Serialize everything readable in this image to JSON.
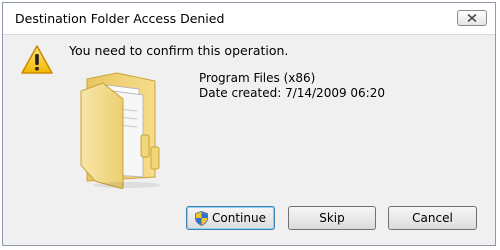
{
  "dialog": {
    "title": "Destination Folder Access Denied",
    "message": "You need to confirm this operation.",
    "item": {
      "name": "Program Files (x86)",
      "date_created": "Date created: 7/14/2009 06:20"
    },
    "buttons": {
      "continue_label": "Continue",
      "skip_label": "Skip",
      "cancel_label": "Cancel"
    },
    "icons": {
      "warning": "warning-icon",
      "folder": "folder-icon",
      "shield": "uac-shield-icon",
      "close": "close-icon"
    }
  }
}
